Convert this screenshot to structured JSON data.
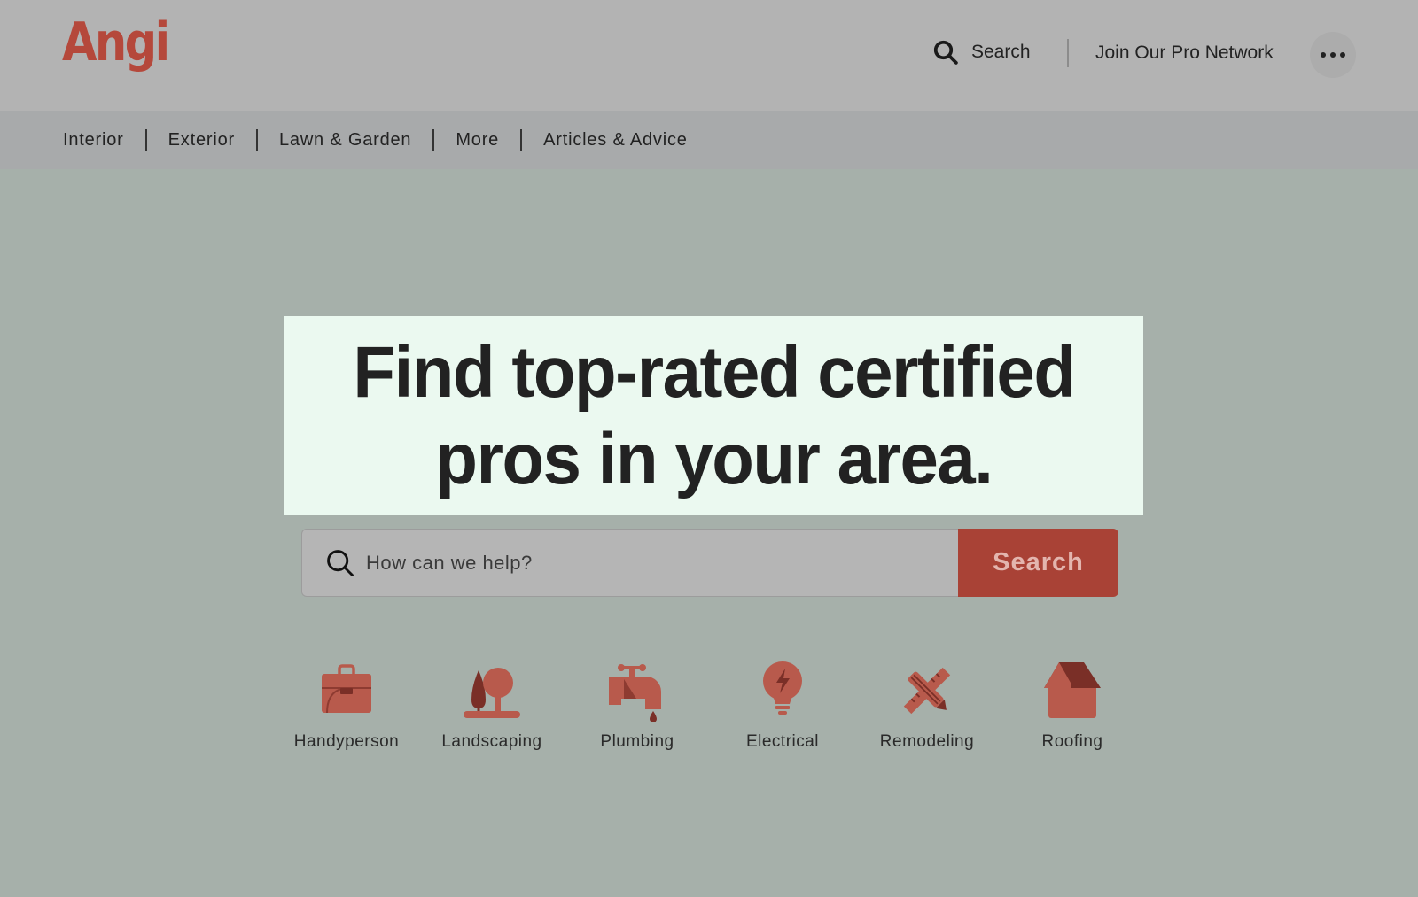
{
  "header": {
    "logo": "Angi",
    "search_label": "Search",
    "join_label": "Join Our Pro Network",
    "more_icon": "ellipsis-icon"
  },
  "nav": {
    "items": [
      {
        "label": "Interior"
      },
      {
        "label": "Exterior"
      },
      {
        "label": "Lawn & Garden"
      },
      {
        "label": "More"
      },
      {
        "label": "Articles & Advice"
      }
    ]
  },
  "hero": {
    "title_line1": "Find top-rated certified",
    "title_line2": "pros in your area."
  },
  "search": {
    "placeholder": "How can we help?",
    "value": "",
    "button_label": "Search"
  },
  "categories": [
    {
      "label": "Handyperson",
      "icon": "toolbox-icon"
    },
    {
      "label": "Landscaping",
      "icon": "trees-icon"
    },
    {
      "label": "Plumbing",
      "icon": "faucet-icon"
    },
    {
      "label": "Electrical",
      "icon": "lightbulb-icon"
    },
    {
      "label": "Remodeling",
      "icon": "pencil-ruler-icon"
    },
    {
      "label": "Roofing",
      "icon": "house-icon"
    }
  ],
  "colors": {
    "brand": "#b5483b",
    "button": "#a94236",
    "icon_light": "#b85a4c",
    "icon_dark": "#7a2f27",
    "hero_bg": "#ebf9f0"
  }
}
